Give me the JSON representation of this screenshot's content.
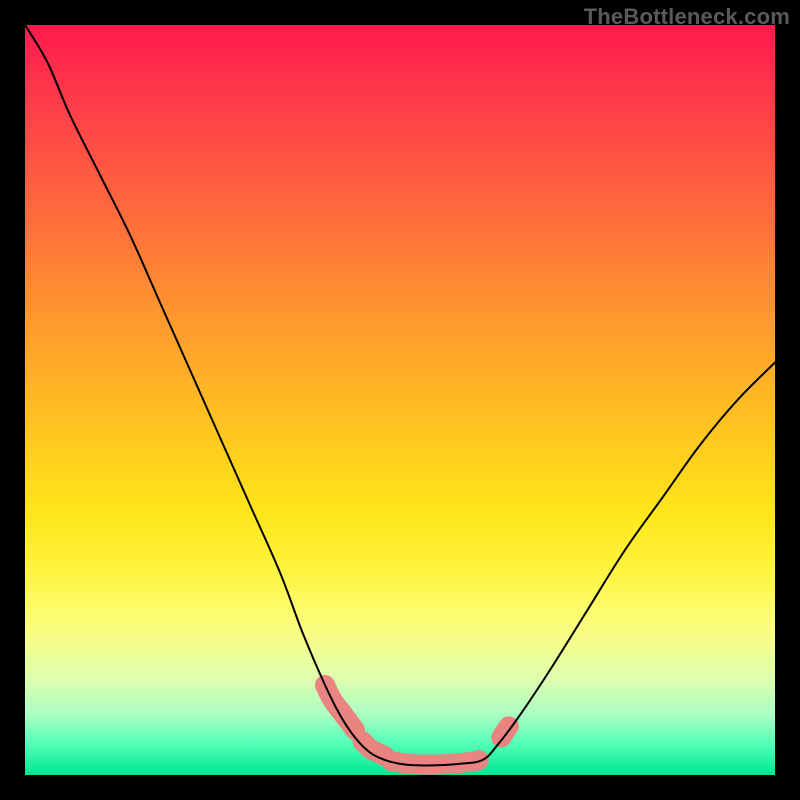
{
  "watermark": "TheBottleneck.com",
  "chart_data": {
    "type": "line",
    "title": "",
    "xlabel": "",
    "ylabel": "",
    "xlim": [
      0,
      100
    ],
    "ylim": [
      0,
      100
    ],
    "series": [
      {
        "name": "left-curve",
        "x": [
          0,
          3,
          6,
          10,
          14,
          18,
          22,
          26,
          30,
          34,
          37,
          40,
          42,
          44,
          46,
          48
        ],
        "values": [
          100,
          95,
          88,
          80,
          72,
          63,
          54,
          45,
          36,
          27,
          19,
          12,
          8,
          5,
          3,
          2
        ]
      },
      {
        "name": "bottom-flat",
        "x": [
          48,
          50,
          52,
          55,
          58,
          61
        ],
        "values": [
          2,
          1.5,
          1.3,
          1.3,
          1.5,
          2
        ]
      },
      {
        "name": "right-curve",
        "x": [
          61,
          63,
          66,
          70,
          75,
          80,
          85,
          90,
          95,
          100
        ],
        "values": [
          2,
          4,
          8,
          14,
          22,
          30,
          37,
          44,
          50,
          55
        ]
      }
    ],
    "marker_segments": [
      {
        "name": "left-descent-blob-upper",
        "x": [
          40,
          41,
          42.5,
          44
        ],
        "values": [
          12,
          10,
          8,
          6
        ]
      },
      {
        "name": "left-descent-blob-lower",
        "x": [
          45,
          46,
          47,
          48
        ],
        "values": [
          4.5,
          3.5,
          3,
          2.5
        ]
      },
      {
        "name": "bottom-blob",
        "x": [
          49,
          51,
          53,
          55,
          57,
          59,
          60.5
        ],
        "values": [
          1.8,
          1.5,
          1.4,
          1.4,
          1.5,
          1.7,
          2
        ]
      },
      {
        "name": "right-ascent-dot",
        "x": [
          63.5,
          64.5
        ],
        "values": [
          5,
          6.5
        ]
      }
    ],
    "colors": {
      "curve": "#000000",
      "marker": "#e98480"
    }
  }
}
